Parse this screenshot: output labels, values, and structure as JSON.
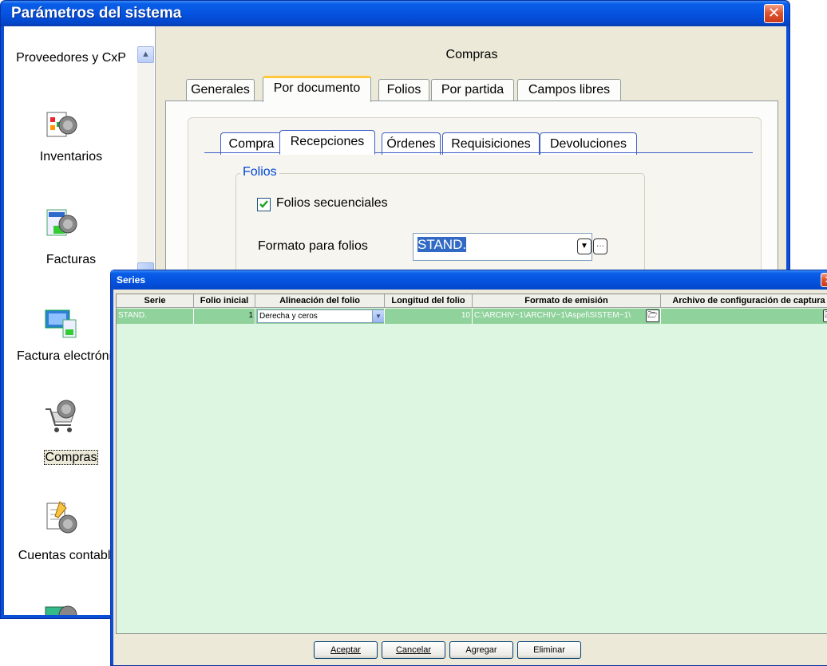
{
  "main_window": {
    "title": "Parámetros del sistema",
    "close_glyph": "✕"
  },
  "sidebar": {
    "items": [
      {
        "label": "Proveedores y CxP",
        "icon": "suppliers-icon"
      },
      {
        "label": "Inventarios",
        "icon": "inventory-icon"
      },
      {
        "label": "Facturas",
        "icon": "invoices-icon"
      },
      {
        "label": "Factura electrónica",
        "icon": "e-invoice-icon"
      },
      {
        "label": "Compras",
        "icon": "shopping-cart-icon",
        "selected": true
      },
      {
        "label": "Cuentas contables",
        "icon": "accounts-icon"
      }
    ]
  },
  "content": {
    "header": "Compras",
    "tabs": [
      "Generales",
      "Por documento",
      "Folios",
      "Por partida",
      "Campos libres"
    ],
    "selected_tab": "Por documento",
    "inner_tabs": [
      "Compra",
      "Recepciones",
      "Órdenes",
      "Requisiciones",
      "Devoluciones"
    ],
    "selected_inner_tab": "Recepciones",
    "folios_group": {
      "legend": "Folios",
      "sequential_label": "Folios secuenciales",
      "sequential_checked": true,
      "format_label": "Formato para folios",
      "format_value": "STAND."
    }
  },
  "series_window": {
    "title": "Series",
    "close_glyph": "✕",
    "columns": [
      "Serie",
      "Folio inicial",
      "Alineación del folio",
      "Longitud del folio",
      "Formato de emisión",
      "Archivo de configuración de captura"
    ],
    "rows": [
      {
        "serie": "STAND.",
        "folio_inicial": "1",
        "alineacion": "Derecha y ceros",
        "longitud": "10",
        "formato_emision": "C:\\ARCHIV~1\\ARCHIV~1\\Aspel\\SISTEM~1\\",
        "archivo_config": ""
      }
    ],
    "buttons": {
      "accept": "Aceptar",
      "cancel": "Cancelar",
      "add": "Agregar",
      "delete": "Eliminar"
    }
  },
  "colors": {
    "titlebar": "#0553e0",
    "grid_background": "#dcf6e1",
    "selected_row": "#8fd29b",
    "selection_highlight": "#316ac5"
  }
}
